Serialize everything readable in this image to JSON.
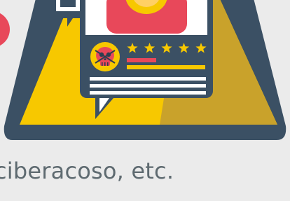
{
  "caption": "ciberacoso, etc.",
  "illustration": {
    "stars": 5,
    "colors": {
      "background": "#ebebeb",
      "frame": "#3b5064",
      "triangle_fill": "#f7c800",
      "triangle_shadow": "#c9a22b",
      "card": "#ffffff",
      "red": "#e8485a",
      "star": "#f7c800",
      "skin": "#ffd064",
      "dark": "#2c3e50"
    },
    "icons": [
      "warning-triangle-icon",
      "review-card-icon",
      "skull-icon",
      "star-icon",
      "chat-bubble-icon",
      "user-avatar-icon"
    ]
  }
}
